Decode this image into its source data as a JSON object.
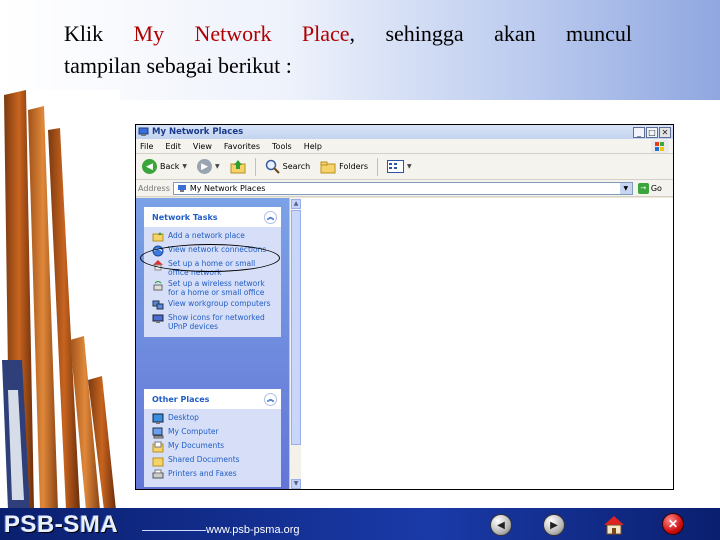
{
  "slide": {
    "line1_words": [
      "Klik",
      "My",
      "Network",
      "Place,",
      "sehingga",
      "akan",
      "muncul"
    ],
    "line2": "tampilan sebagai berikut :"
  },
  "explorer": {
    "title": "My Network Places",
    "menu": [
      "File",
      "Edit",
      "View",
      "Favorites",
      "Tools",
      "Help"
    ],
    "toolbar": {
      "back": "Back",
      "search": "Search",
      "folders": "Folders"
    },
    "address_label": "Address",
    "address_value": "My Network Places",
    "go_label": "Go",
    "network_tasks": {
      "title": "Network Tasks",
      "items": [
        "Add a network place",
        "View network connections",
        "Set up a home or small office network",
        "Set up a wireless network for a home or small office",
        "View workgroup computers",
        "Show icons for networked UPnP devices"
      ]
    },
    "other_places": {
      "title": "Other Places",
      "items": [
        "Desktop",
        "My Computer",
        "My Documents",
        "Shared Documents",
        "Printers and Faxes"
      ]
    }
  },
  "footer": {
    "logo": "PSB-SMA",
    "url": "www.psb-psma.org"
  },
  "colors": {
    "accent_red": "#b00000",
    "xp_blue_link": "#215dc6",
    "footer_blue": "#1a3aa8"
  }
}
